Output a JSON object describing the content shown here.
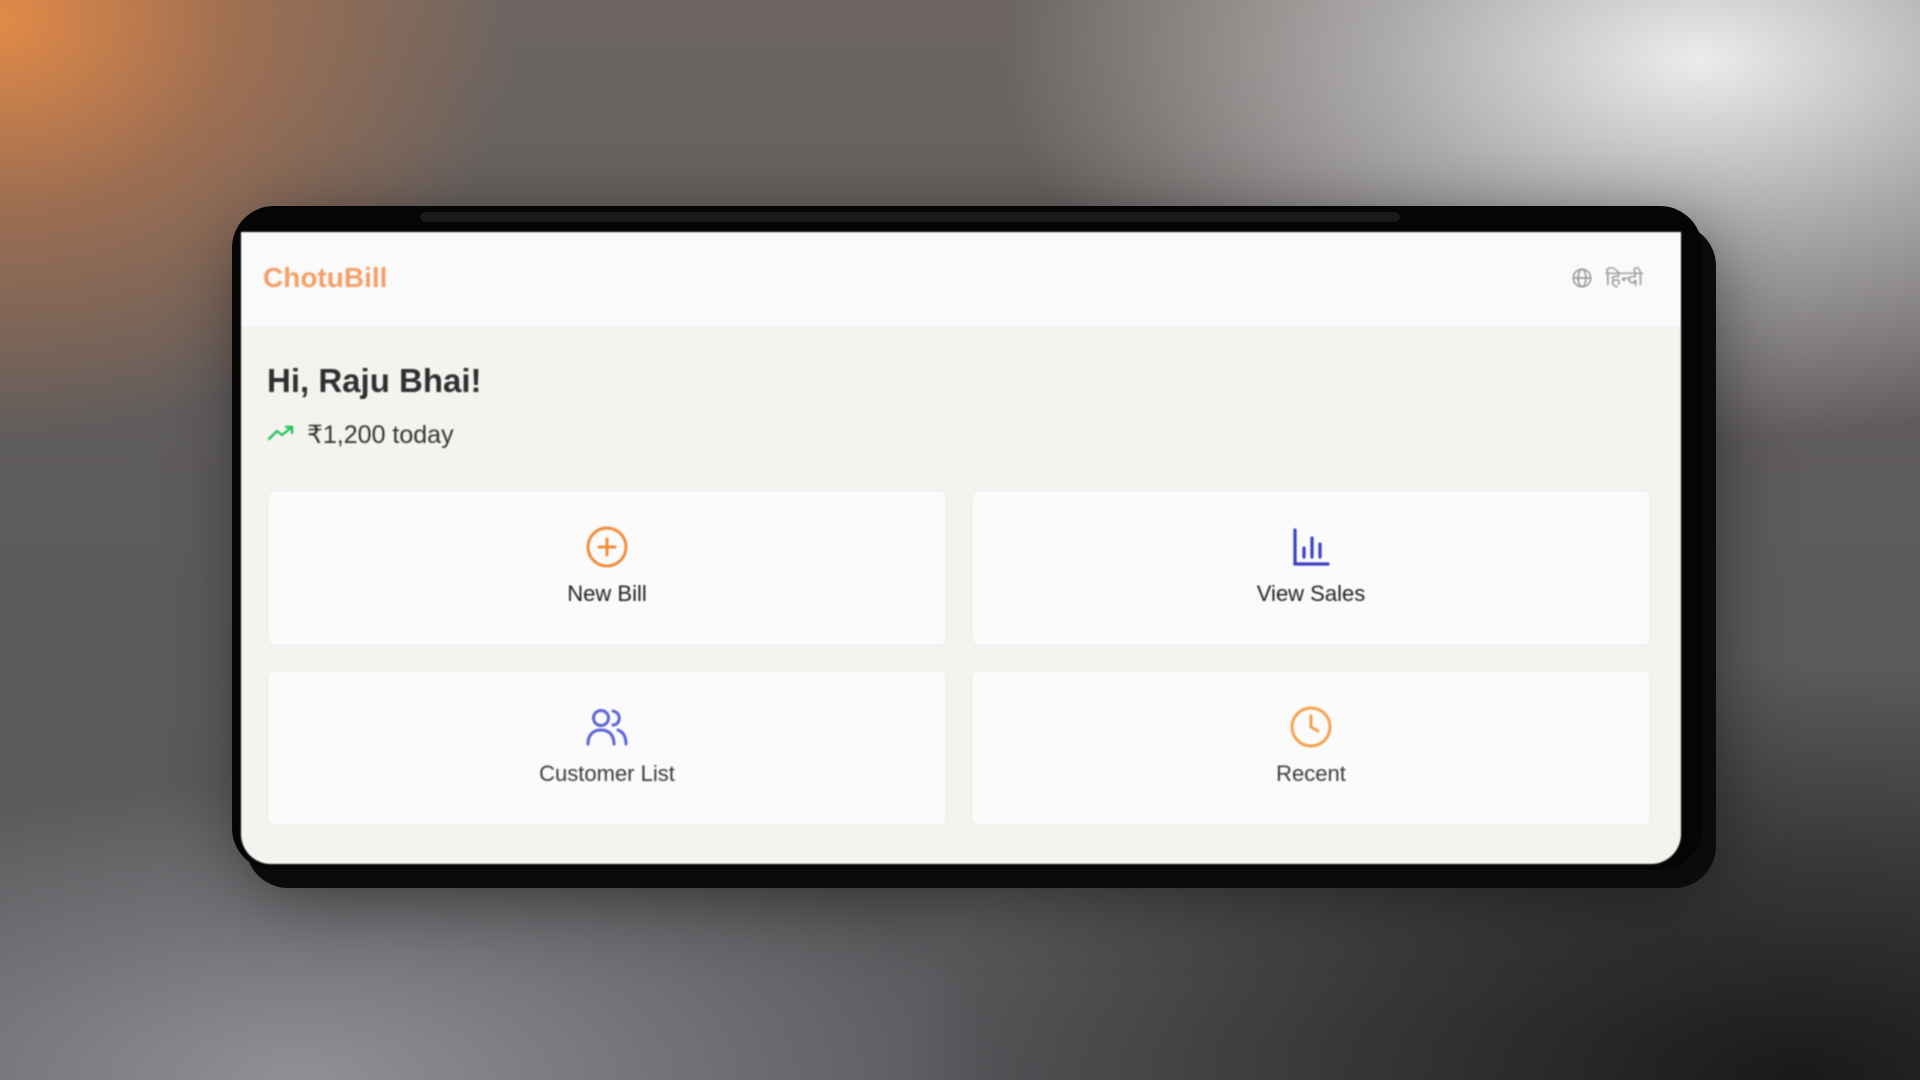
{
  "app": {
    "name": "ChotuBill",
    "brand_color": "#f4a06a"
  },
  "header": {
    "language_icon": "globe-icon",
    "language_label": "हिन्दी"
  },
  "home": {
    "greeting": "Hi, Raju Bhai!",
    "sales_icon": "trending-up-icon",
    "sales_today": "₹1,200 today",
    "trend_color": "#22c55e"
  },
  "actions": [
    {
      "label": "New Bill",
      "icon": "plus-circle-icon",
      "color": "#f28c3a"
    },
    {
      "label": "View Sales",
      "icon": "bar-chart-icon",
      "color": "#3b3fc4"
    },
    {
      "label": "Customer List",
      "icon": "users-icon",
      "color": "#5b63d3"
    },
    {
      "label": "Recent",
      "icon": "clock-icon",
      "color": "#f6a04d"
    }
  ]
}
